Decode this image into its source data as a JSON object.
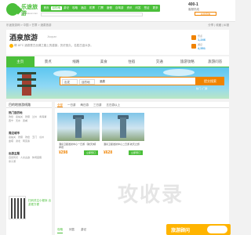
{
  "header": {
    "logo_text": "乐途旅游",
    "logo_sub": "www.lotour.com",
    "nav": [
      "首页",
      "目的地",
      "游记",
      "攻略",
      "酒店",
      "机票",
      "门票",
      "度假",
      "自驾游",
      "资讯",
      "问答",
      "签证",
      "更多"
    ],
    "nav_active_index": 1,
    "hotline": "400-1",
    "hotline_sub": "客服热线",
    "hotline_button": "在线咨询"
  },
  "breadcrumb": {
    "text": "乐途旅游网 > 中国 > 甘肃 > 酒泉旅游",
    "right": "分享 | 收藏 | 纠错"
  },
  "title": {
    "name": "酒泉旅游",
    "en": "Jiuquan",
    "weather": "晴 18°C  酒泉是古丝绸之路上的重镇，历史悠久，名胜古迹众多。",
    "stats": [
      {
        "label": "景点",
        "value": "1,246"
      },
      {
        "label": "游记",
        "value": "4,551"
      }
    ]
  },
  "section_nav": [
    "主页",
    "景点",
    "线路",
    "美食",
    "住宿",
    "交通",
    "旅游攻略",
    "旅游问答"
  ],
  "section_nav_active_index": 0,
  "hero": {
    "select1": "出发",
    "select2": "目的地",
    "search_value": "酒泉",
    "button": "提交搜索",
    "links": "热门 | 门票"
  },
  "sidebar": {
    "header": "目的地旅游线路",
    "blocks": [
      {
        "title": "热门目的地",
        "items": [
          "敦煌",
          "嘉峪关",
          "张掖",
          "兰州",
          "青海湖",
          "西宁",
          "天水",
          "武威"
        ]
      },
      {
        "title": "周边城市",
        "items": [
          "嘉峪关",
          "张掖",
          "敦煌",
          "玉门",
          "瓜州",
          "金塔",
          "肃北",
          "阿克塞"
        ]
      },
      {
        "title": "出游主题",
        "items": [
          "自然风光",
          "人文古迹",
          "休闲度假",
          "亲子游"
        ]
      }
    ],
    "qr_caption": "扫码关注小程序 出游更方便"
  },
  "main": {
    "filter_tabs": [
      "全部",
      "一日游",
      "两日游",
      "三日游",
      "五日游以上"
    ],
    "filter_active_index": 0,
    "cards": [
      {
        "caption": "酒泉卫星发射中心一日游 【航天城】参观",
        "price": "¥298",
        "button": "立即预订"
      },
      {
        "caption": "酒泉卫星发射中心二日游 航天之旅",
        "price": "¥628",
        "button": "立即预订"
      }
    ]
  },
  "bottom": {
    "tabs": [
      "攻略",
      "问答",
      "游记"
    ],
    "active_index": 0,
    "float_text": "旅游顾问"
  },
  "watermark": "攻收录"
}
